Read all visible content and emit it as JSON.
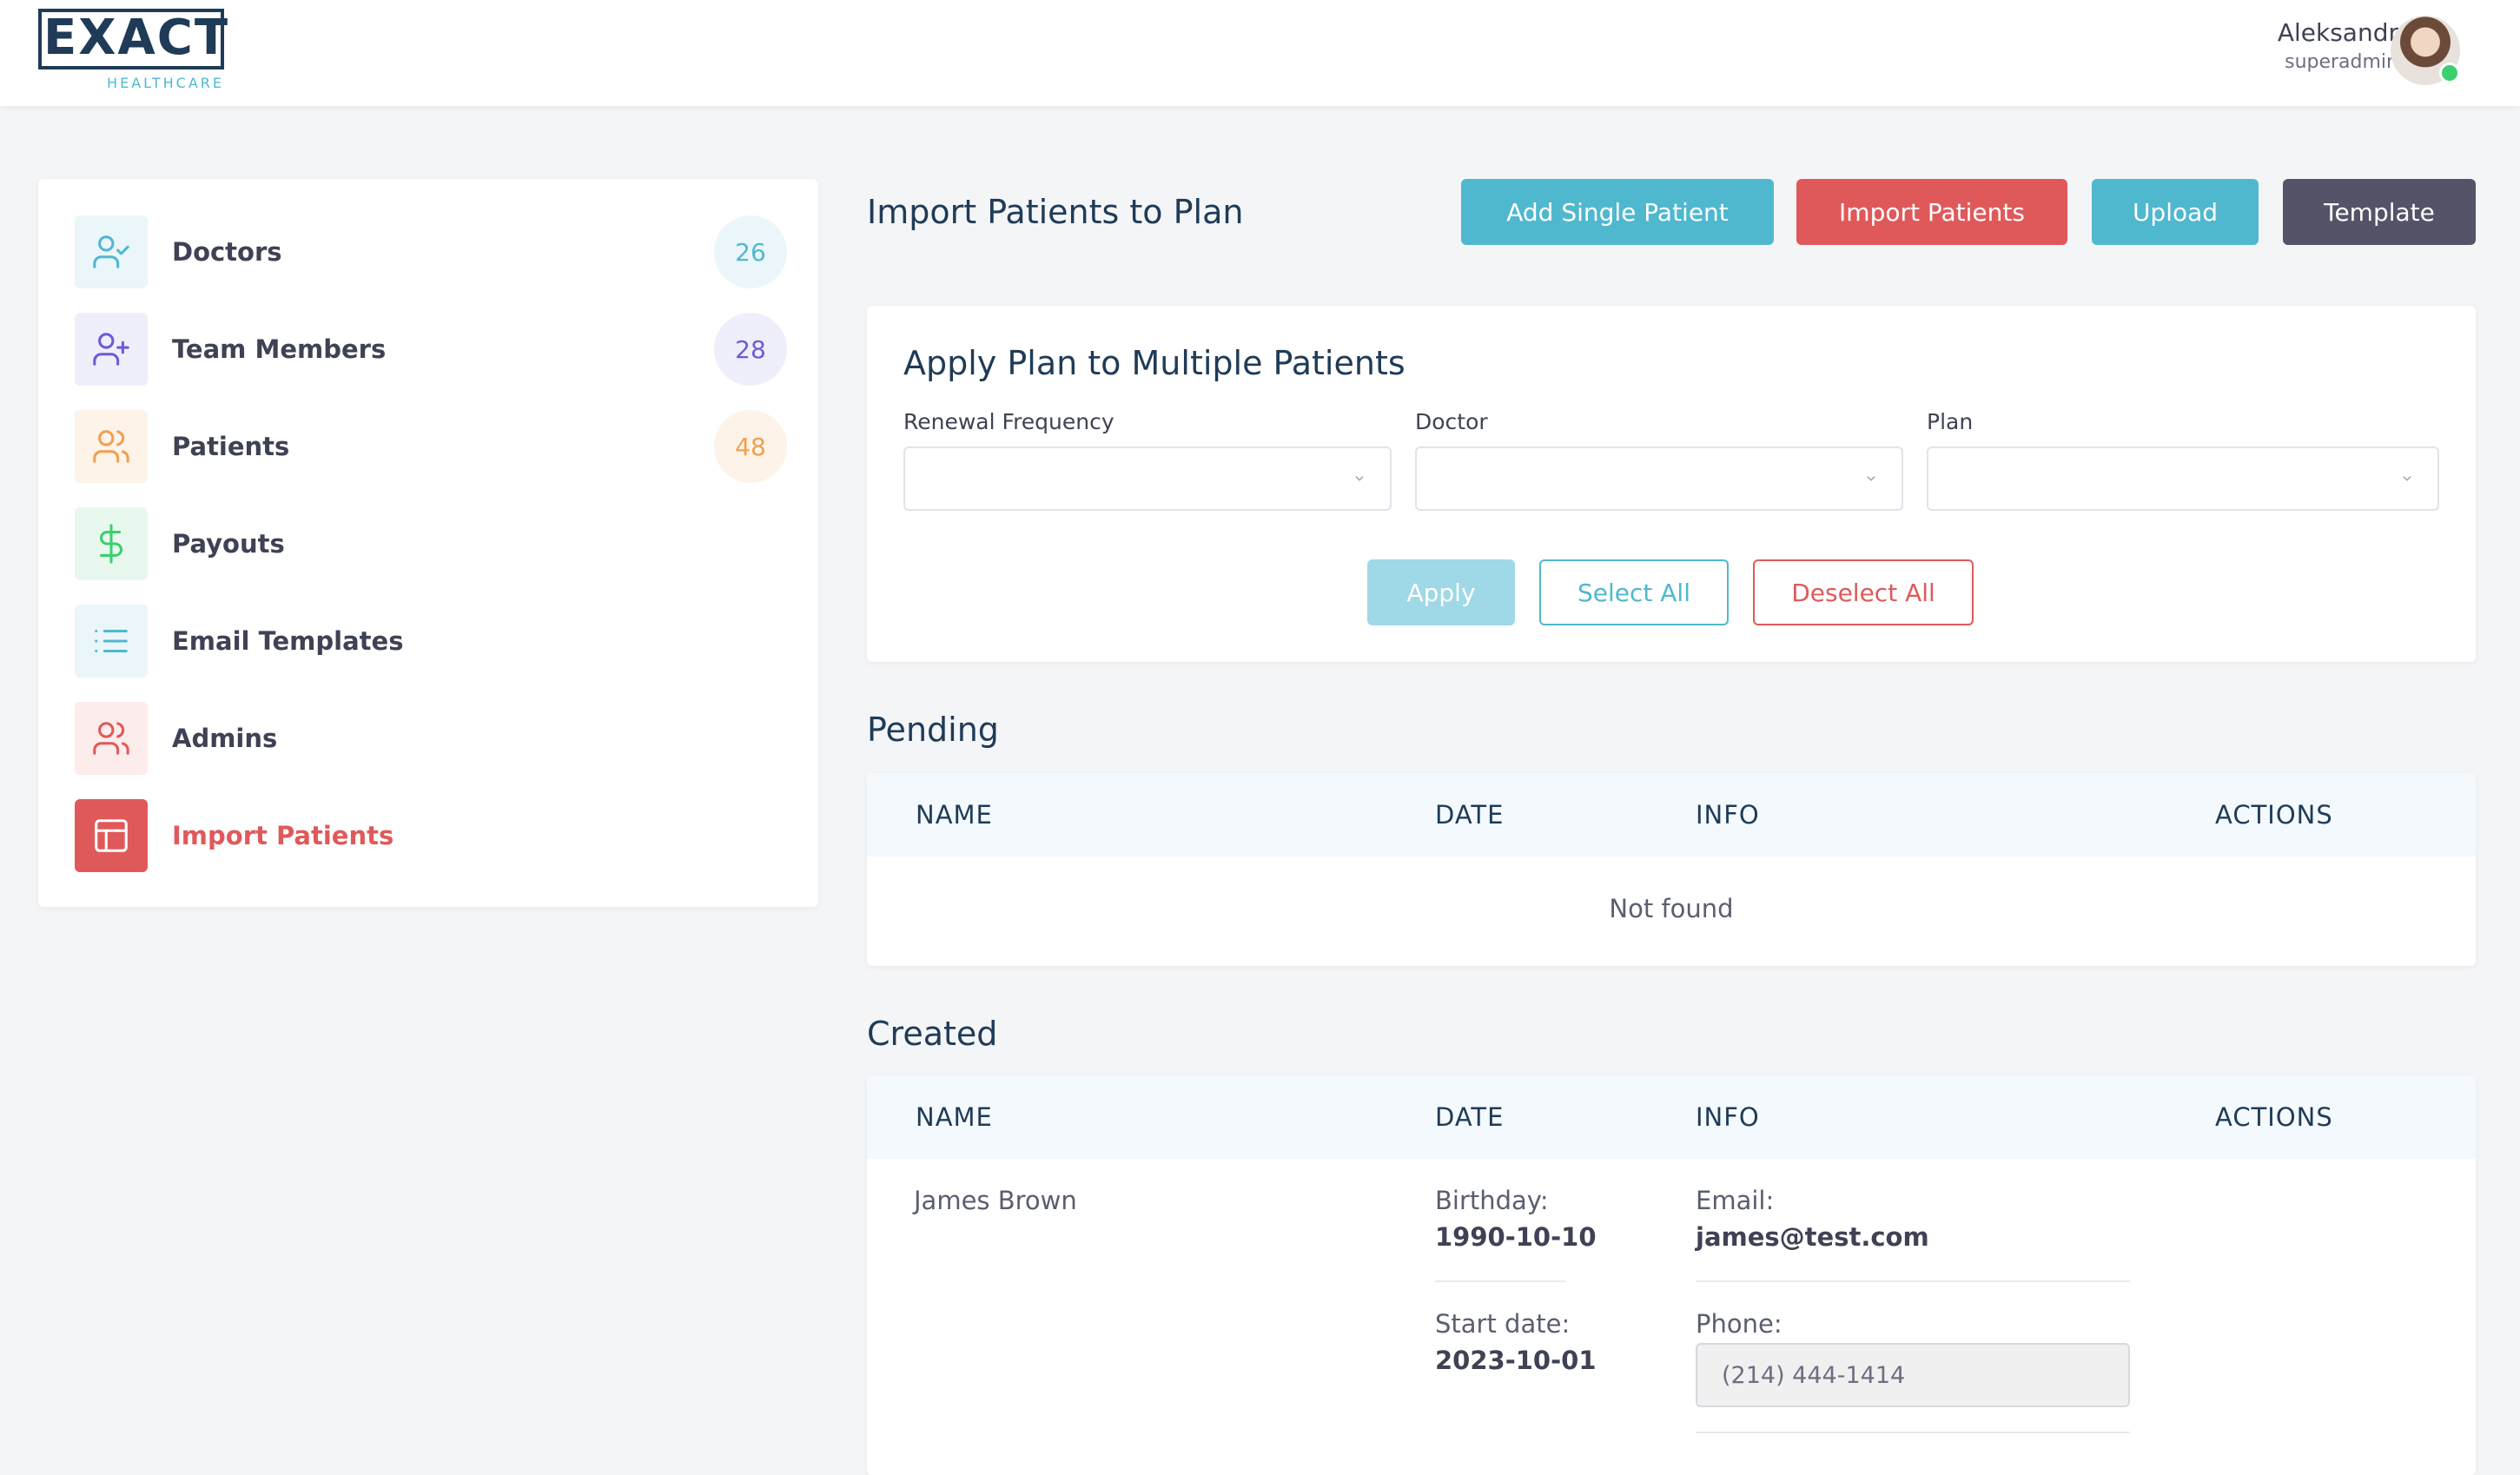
{
  "header": {
    "logo_main": "EXACT",
    "logo_sub": "HEALTHCARE",
    "user_name": "Aleksandr",
    "user_role": "superadmin"
  },
  "sidebar": {
    "items": [
      {
        "label": "Doctors",
        "count": "26",
        "icon": "user-check-icon",
        "color": "#4fb8cf",
        "bg": "#eaf6fa"
      },
      {
        "label": "Team Members",
        "count": "28",
        "icon": "user-plus-icon",
        "color": "#6a5cd8",
        "bg": "#efeefb"
      },
      {
        "label": "Patients",
        "count": "48",
        "icon": "users-icon",
        "color": "#f0a050",
        "bg": "#fdf3e8"
      },
      {
        "label": "Payouts",
        "icon": "dollar-icon",
        "color": "#3ccf6e",
        "bg": "#e9f8ee"
      },
      {
        "label": "Email Templates",
        "icon": "list-icon",
        "color": "#4fb8cf",
        "bg": "#eaf6fa"
      },
      {
        "label": "Admins",
        "icon": "users-icon",
        "color": "#e0595a",
        "bg": "#fdecec"
      },
      {
        "label": "Import Patients",
        "icon": "layout-icon",
        "color": "#ffffff",
        "bg": "#e0595a",
        "active": true
      }
    ]
  },
  "main": {
    "title": "Import Patients to Plan",
    "buttons": {
      "add_single": "Add Single Patient",
      "import": "Import Patients",
      "upload": "Upload",
      "template": "Template"
    },
    "apply_card": {
      "title": "Apply Plan to Multiple Patients",
      "renewal_label": "Renewal Frequency",
      "doctor_label": "Doctor",
      "plan_label": "Plan",
      "renewal_value": "",
      "doctor_value": "",
      "plan_value": "",
      "apply": "Apply",
      "select_all": "Select All",
      "deselect_all": "Deselect All"
    },
    "pending": {
      "title": "Pending",
      "columns": [
        "NAME",
        "DATE",
        "INFO",
        "ACTIONS"
      ],
      "empty": "Not found"
    },
    "created": {
      "title": "Created",
      "columns": [
        "NAME",
        "DATE",
        "INFO",
        "ACTIONS"
      ],
      "rows": [
        {
          "name": "James Brown",
          "birthday_label": "Birthday:",
          "birthday": "1990-10-10",
          "start_label": "Start date:",
          "start": "2023-10-01",
          "email_label": "Email:",
          "email": "james@test.com",
          "phone_label": "Phone:",
          "phone": "(214) 444-1414"
        }
      ]
    }
  },
  "colors": {
    "teal": "#4fb8cf",
    "red": "#e0595a",
    "dark": "#545368",
    "navy": "#1f3b57"
  }
}
